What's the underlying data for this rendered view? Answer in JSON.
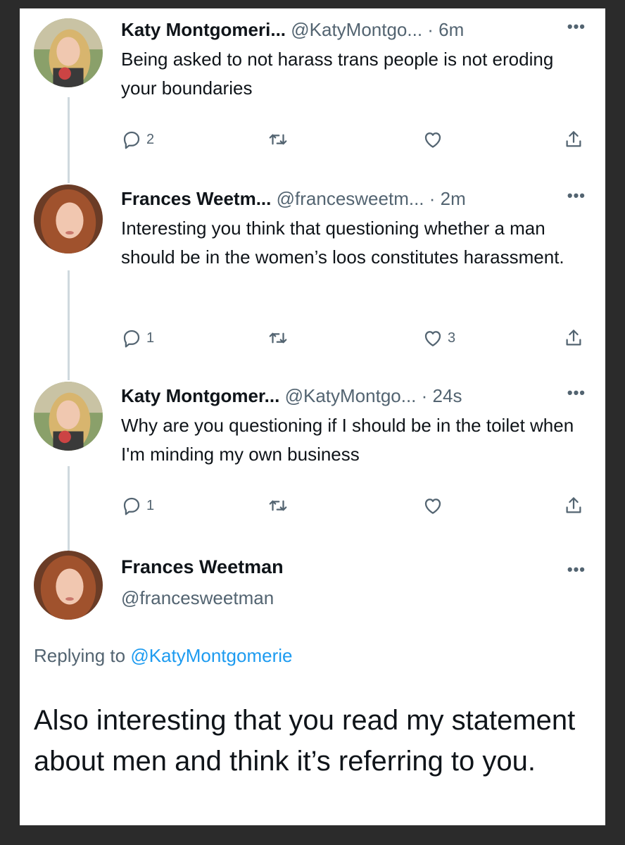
{
  "tweets": [
    {
      "name": "Katy Montgomeri...",
      "handle": "@KatyMontgo...",
      "time": "· 6m",
      "more": "•••",
      "text": "Being asked to not harass trans people is not eroding your boundaries",
      "replies": "2",
      "retweets": "",
      "likes": ""
    },
    {
      "name": "Frances Weetm...",
      "handle": "@francesweetm...",
      "time": "· 2m",
      "more": "•••",
      "text": "Interesting you think that questioning whether a man should be in the women’s loos constitutes harassment.",
      "replies": "1",
      "retweets": "",
      "likes": "3"
    },
    {
      "name": "Katy Montgomer...",
      "handle": "@KatyMontgo...",
      "time": "· 24s",
      "more": "•••",
      "text": "Why are you questioning if I should be in the toilet when I'm minding my own business",
      "replies": "1",
      "retweets": "",
      "likes": ""
    }
  ],
  "main_tweet": {
    "name": "Frances Weetman",
    "handle": "@francesweetman",
    "more": "•••",
    "replying_prefix": "Replying to ",
    "replying_handle": "@KatyMontgomerie",
    "text": "Also interesting that you read my statement about men and think it’s referring to you."
  },
  "icons": {
    "reply": "reply-icon",
    "retweet": "retweet-icon",
    "like": "heart-icon",
    "share": "share-icon",
    "more": "more-icon"
  },
  "colors": {
    "text_primary": "#0f1419",
    "text_secondary": "#536471",
    "link": "#1d9bf0",
    "thread_line": "#cfd9de",
    "frame": "#2b2b2b"
  }
}
